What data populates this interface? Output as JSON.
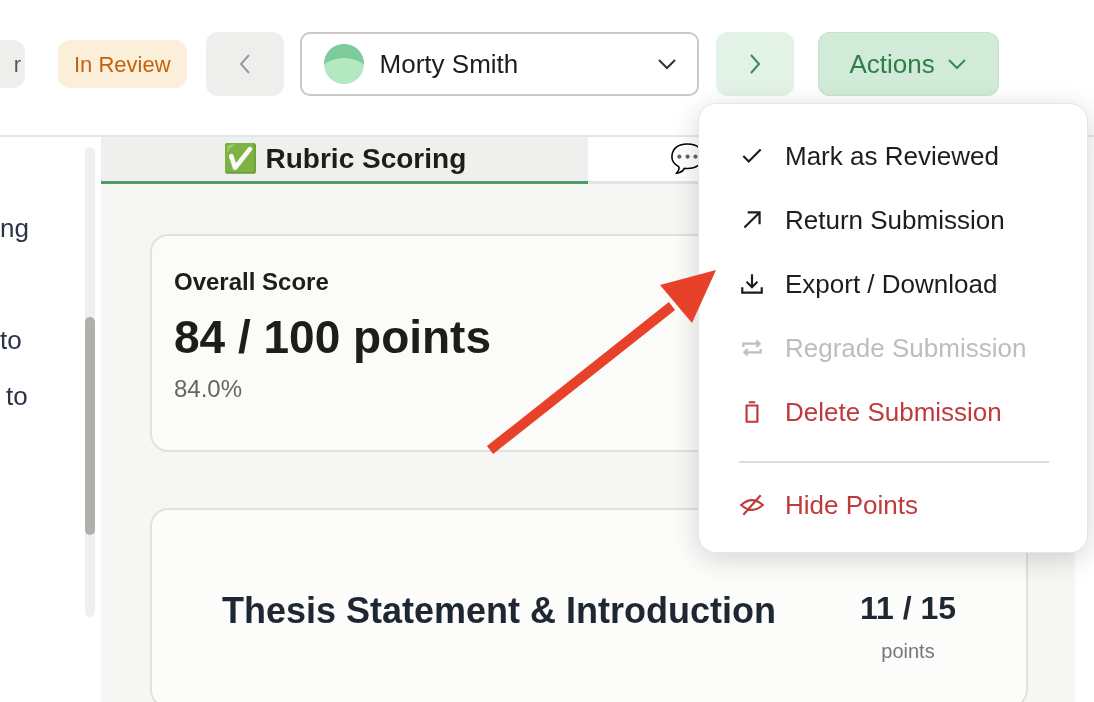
{
  "header": {
    "status_chip_partial": "r",
    "status_badge": "In Review",
    "student_select": {
      "value": "Morty Smith"
    },
    "actions_button": {
      "label": "Actions",
      "expanded": true
    }
  },
  "sidebar": {
    "fragments": [
      "ng",
      "to",
      "to"
    ]
  },
  "tabs": [
    {
      "label": "✅ Rubric Scoring",
      "selected": true
    },
    {
      "label": "💬",
      "selected": false
    }
  ],
  "score_card": {
    "title": "Overall Score",
    "score": "84 / 100 points",
    "percent": "84.0%"
  },
  "criterion": {
    "title": "Thesis Statement & Introduction",
    "score": "11 / 15",
    "unit": "points"
  },
  "actions_menu": [
    {
      "label": "Mark as Reviewed",
      "disabled": false,
      "danger": false
    },
    {
      "label": "Return Submission",
      "disabled": false,
      "danger": false
    },
    {
      "label": "Export / Download",
      "disabled": false,
      "danger": false
    },
    {
      "label": "Regrade Submission",
      "disabled": true,
      "danger": false
    },
    {
      "label": "Delete Submission",
      "disabled": false,
      "danger": true,
      "divider_after": true
    },
    {
      "label": "Hide Points",
      "disabled": false,
      "danger": true
    }
  ]
}
